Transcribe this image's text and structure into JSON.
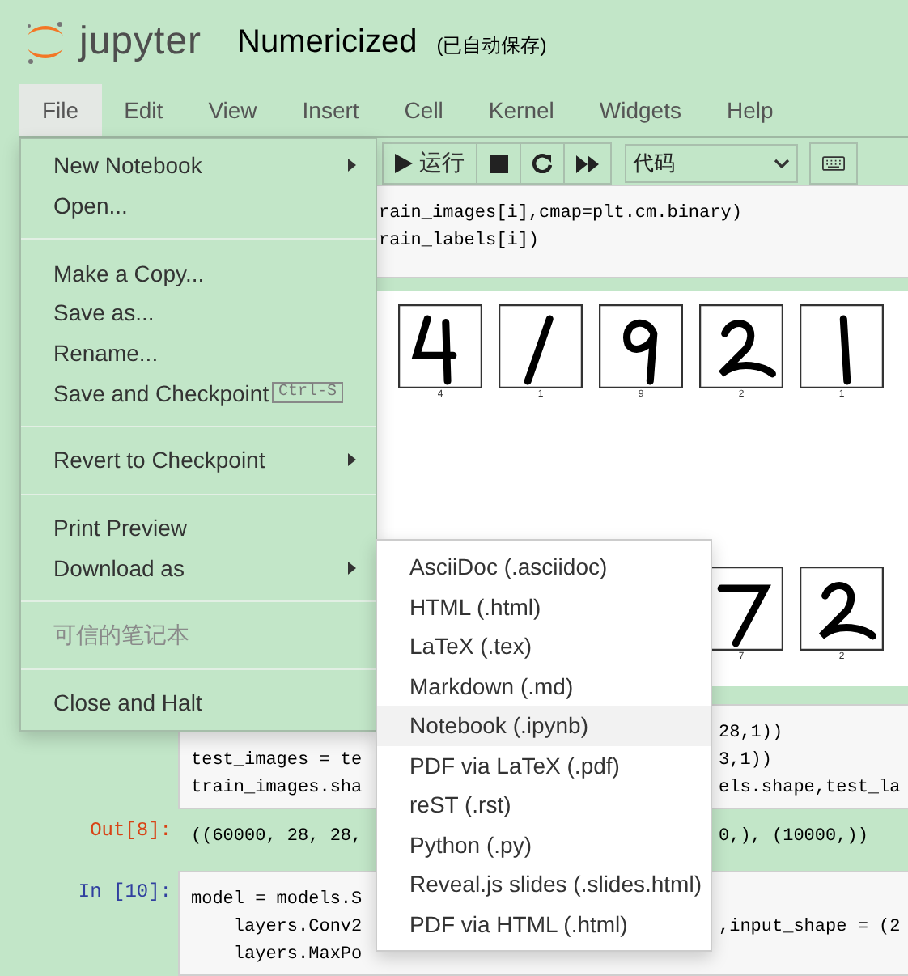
{
  "header": {
    "logo_text": "jupyter",
    "notebook_title": "Numericized",
    "autosave_status": "(已自动保存)"
  },
  "menu_bar": [
    {
      "label": "File",
      "selected": true
    },
    {
      "label": "Edit",
      "selected": false
    },
    {
      "label": "View",
      "selected": false
    },
    {
      "label": "Insert",
      "selected": false
    },
    {
      "label": "Cell",
      "selected": false
    },
    {
      "label": "Kernel",
      "selected": false
    },
    {
      "label": "Widgets",
      "selected": false
    },
    {
      "label": "Help",
      "selected": false
    }
  ],
  "toolbar": {
    "run_label": "运行",
    "cell_type": "代码"
  },
  "file_menu": [
    [
      {
        "label": "New Notebook",
        "kind": "submenu"
      },
      {
        "label": "Open...",
        "kind": "plain"
      }
    ],
    [
      {
        "label": "Make a Copy...",
        "kind": "plain"
      },
      {
        "label": "Save as...",
        "kind": "plain"
      },
      {
        "label": "Rename...",
        "kind": "plain"
      },
      {
        "label": "Save and Checkpoint",
        "kind": "shortcut",
        "shortcut": "Ctrl-S"
      }
    ],
    [
      {
        "label": "Revert to Checkpoint",
        "kind": "submenu"
      }
    ],
    [
      {
        "label": "Print Preview",
        "kind": "plain"
      },
      {
        "label": "Download as",
        "kind": "submenu"
      }
    ],
    [
      {
        "label": "可信的笔记本",
        "kind": "disabled"
      }
    ],
    [
      {
        "label": "Close and Halt",
        "kind": "plain"
      }
    ]
  ],
  "download_submenu": [
    {
      "label": "AsciiDoc (.asciidoc)",
      "selected": false
    },
    {
      "label": "HTML (.html)",
      "selected": false
    },
    {
      "label": "LaTeX (.tex)",
      "selected": false
    },
    {
      "label": "Markdown (.md)",
      "selected": false
    },
    {
      "label": "Notebook (.ipynb)",
      "selected": true
    },
    {
      "label": "PDF via LaTeX (.pdf)",
      "selected": false
    },
    {
      "label": "reST (.rst)",
      "selected": false
    },
    {
      "label": "Python (.py)",
      "selected": false
    },
    {
      "label": "Reveal.js slides (.slides.html)",
      "selected": false
    },
    {
      "label": "PDF via HTML (.html)",
      "selected": false
    }
  ],
  "cells": [
    {
      "code_lines": [
        {
          "middle": "rain_images[i],cmap=plt.cm.binary)"
        },
        {
          "middle": "rain_labels[i])"
        }
      ],
      "image_rows": [
        [
          {
            "label": "4"
          },
          {
            "label": "1"
          },
          {
            "label": "9"
          },
          {
            "label": "2"
          },
          {
            "label": "1"
          }
        ],
        [
          {
            "label": "7"
          },
          {
            "label": "2"
          }
        ]
      ]
    },
    {
      "code_lines": [
        {
          "right": "28,1))"
        },
        {
          "left": "test_images = te",
          "right": "3,1))"
        },
        {
          "left": "train_images.sha",
          "right": "els.shape,test_la"
        }
      ],
      "output": {
        "prompt": "Out[8]:",
        "line": {
          "left": "((60000, 28, 28,",
          "right": "0,), (10000,))"
        }
      }
    },
    {
      "prompt": "In [10]:",
      "code_lines": [
        {
          "left": "model = models.S"
        },
        {
          "left": "    layers.Conv2",
          "right": ",input_shape = (2"
        },
        {
          "left": "    layers.MaxPo"
        }
      ]
    }
  ]
}
